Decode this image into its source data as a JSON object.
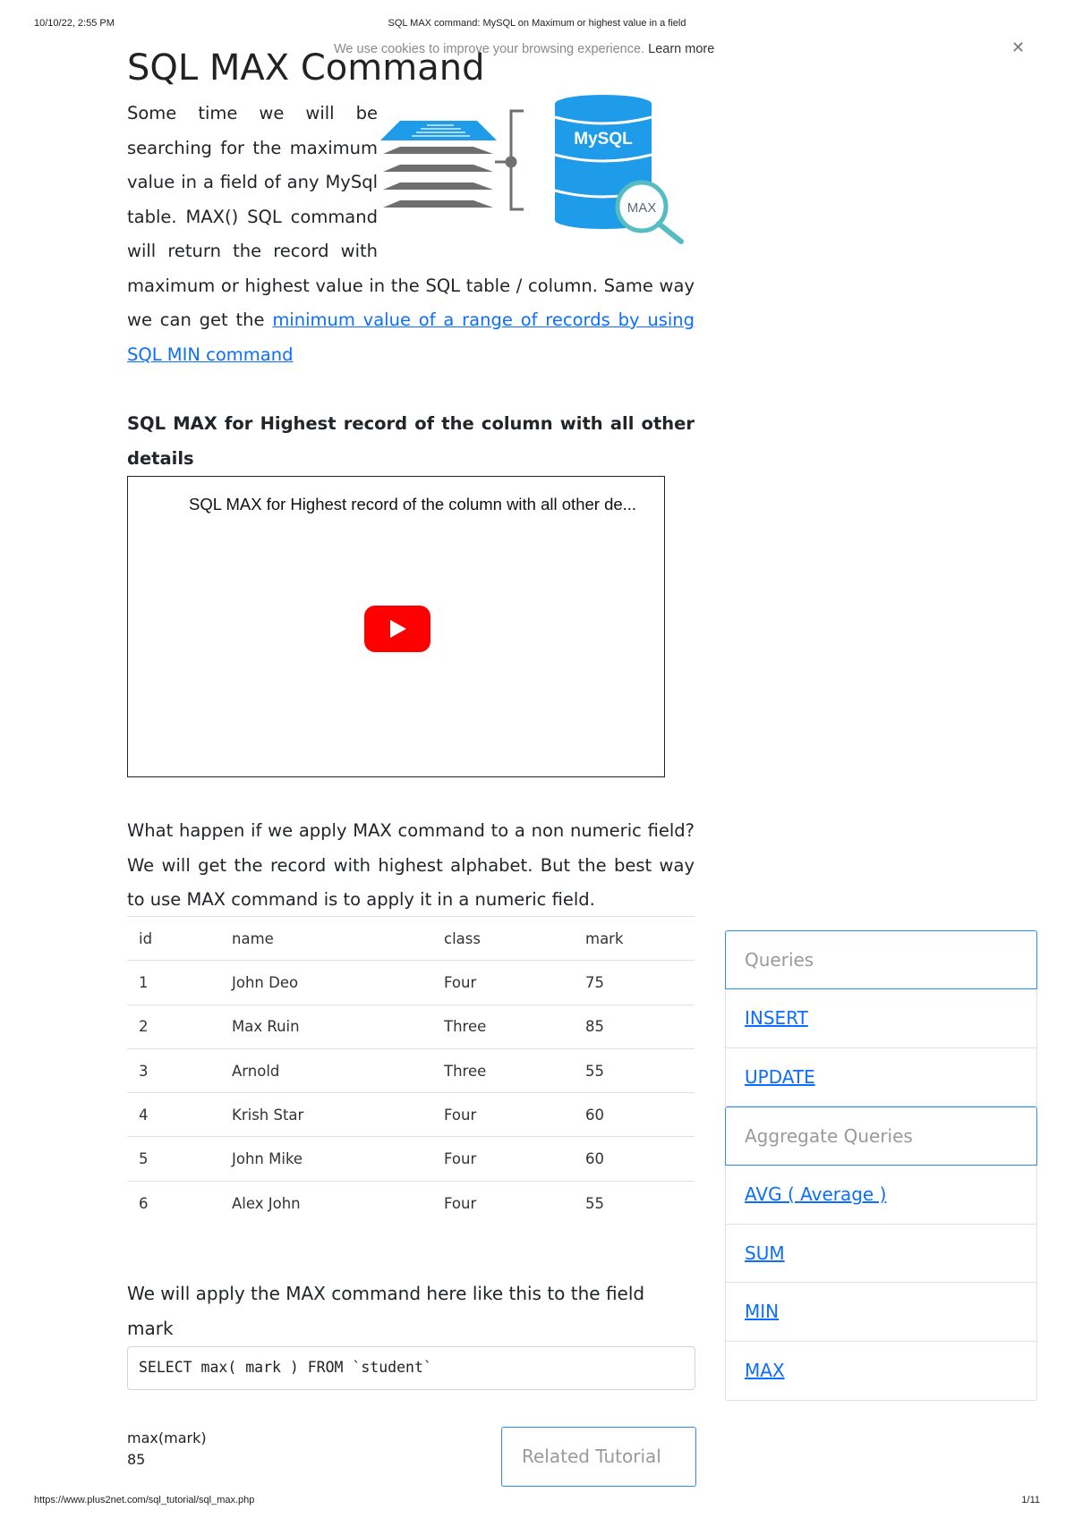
{
  "print_header": {
    "date": "10/10/22, 2:55 PM",
    "title": "SQL MAX command: MySQL on Maximum or highest value in a field"
  },
  "print_footer": {
    "url": "https://www.plus2net.com/sql_tutorial/sql_max.php",
    "page": "1/11"
  },
  "cookie_bar": {
    "text": "We use cookies to improve your browsing experience. ",
    "learn_more": "Learn more",
    "close_icon": "close-icon"
  },
  "page_title": "SQL MAX Command",
  "intro": {
    "narrow_lines": [
      "Some time we will be",
      "searching for the maximum",
      "value in a field of any MySql",
      "table. MAX() SQL command",
      "will return the record with"
    ],
    "wide_text": "maximum or highest value in the SQL table / column. Same way we can get the ",
    "link_text": "minimum value of a range of records by using SQL MIN command"
  },
  "hero_image": {
    "db_label": "MySQL",
    "magnifier_label": "MAX",
    "icons": [
      "table-stack-icon",
      "database-icon",
      "magnifier-icon"
    ]
  },
  "section_heading": "SQL MAX for Highest record of the column with all other details",
  "video": {
    "title": "SQL MAX for Highest record of the column with all other de...",
    "play_icon": "youtube-play-icon"
  },
  "para2": "What happen if we apply MAX command to a non numeric field? We will get the record with highest alphabet. But the best way to use MAX command is to apply it in a numeric field.",
  "table": {
    "columns": [
      "id",
      "name",
      "class",
      "mark"
    ],
    "rows": [
      [
        "1",
        "John Deo",
        "Four",
        "75"
      ],
      [
        "2",
        "Max Ruin",
        "Three",
        "85"
      ],
      [
        "3",
        "Arnold",
        "Three",
        "55"
      ],
      [
        "4",
        "Krish Star",
        "Four",
        "60"
      ],
      [
        "5",
        "John Mike",
        "Four",
        "60"
      ],
      [
        "6",
        "Alex John",
        "Four",
        "55"
      ]
    ]
  },
  "para3": "We will apply the MAX command here like this to the field  mark",
  "code": "SELECT max( mark ) FROM `student`",
  "result": {
    "header": "max(mark)",
    "value": "85"
  },
  "related_tutorial": "Related Tutorial",
  "sidebar": {
    "groups": [
      {
        "header": "Queries",
        "items": [
          "INSERT",
          "UPDATE"
        ]
      },
      {
        "header": "Aggregate Queries",
        "items": [
          "AVG ( Average )",
          "SUM",
          "MIN",
          "MAX"
        ]
      }
    ]
  },
  "colors": {
    "link": "#0d6efd",
    "accent_border": "#2d8cf0",
    "db_blue": "#1e9be9",
    "stack_gray": "#6e6e6e",
    "magnifier_teal": "#56bcc4",
    "youtube_red": "#ff0000"
  }
}
